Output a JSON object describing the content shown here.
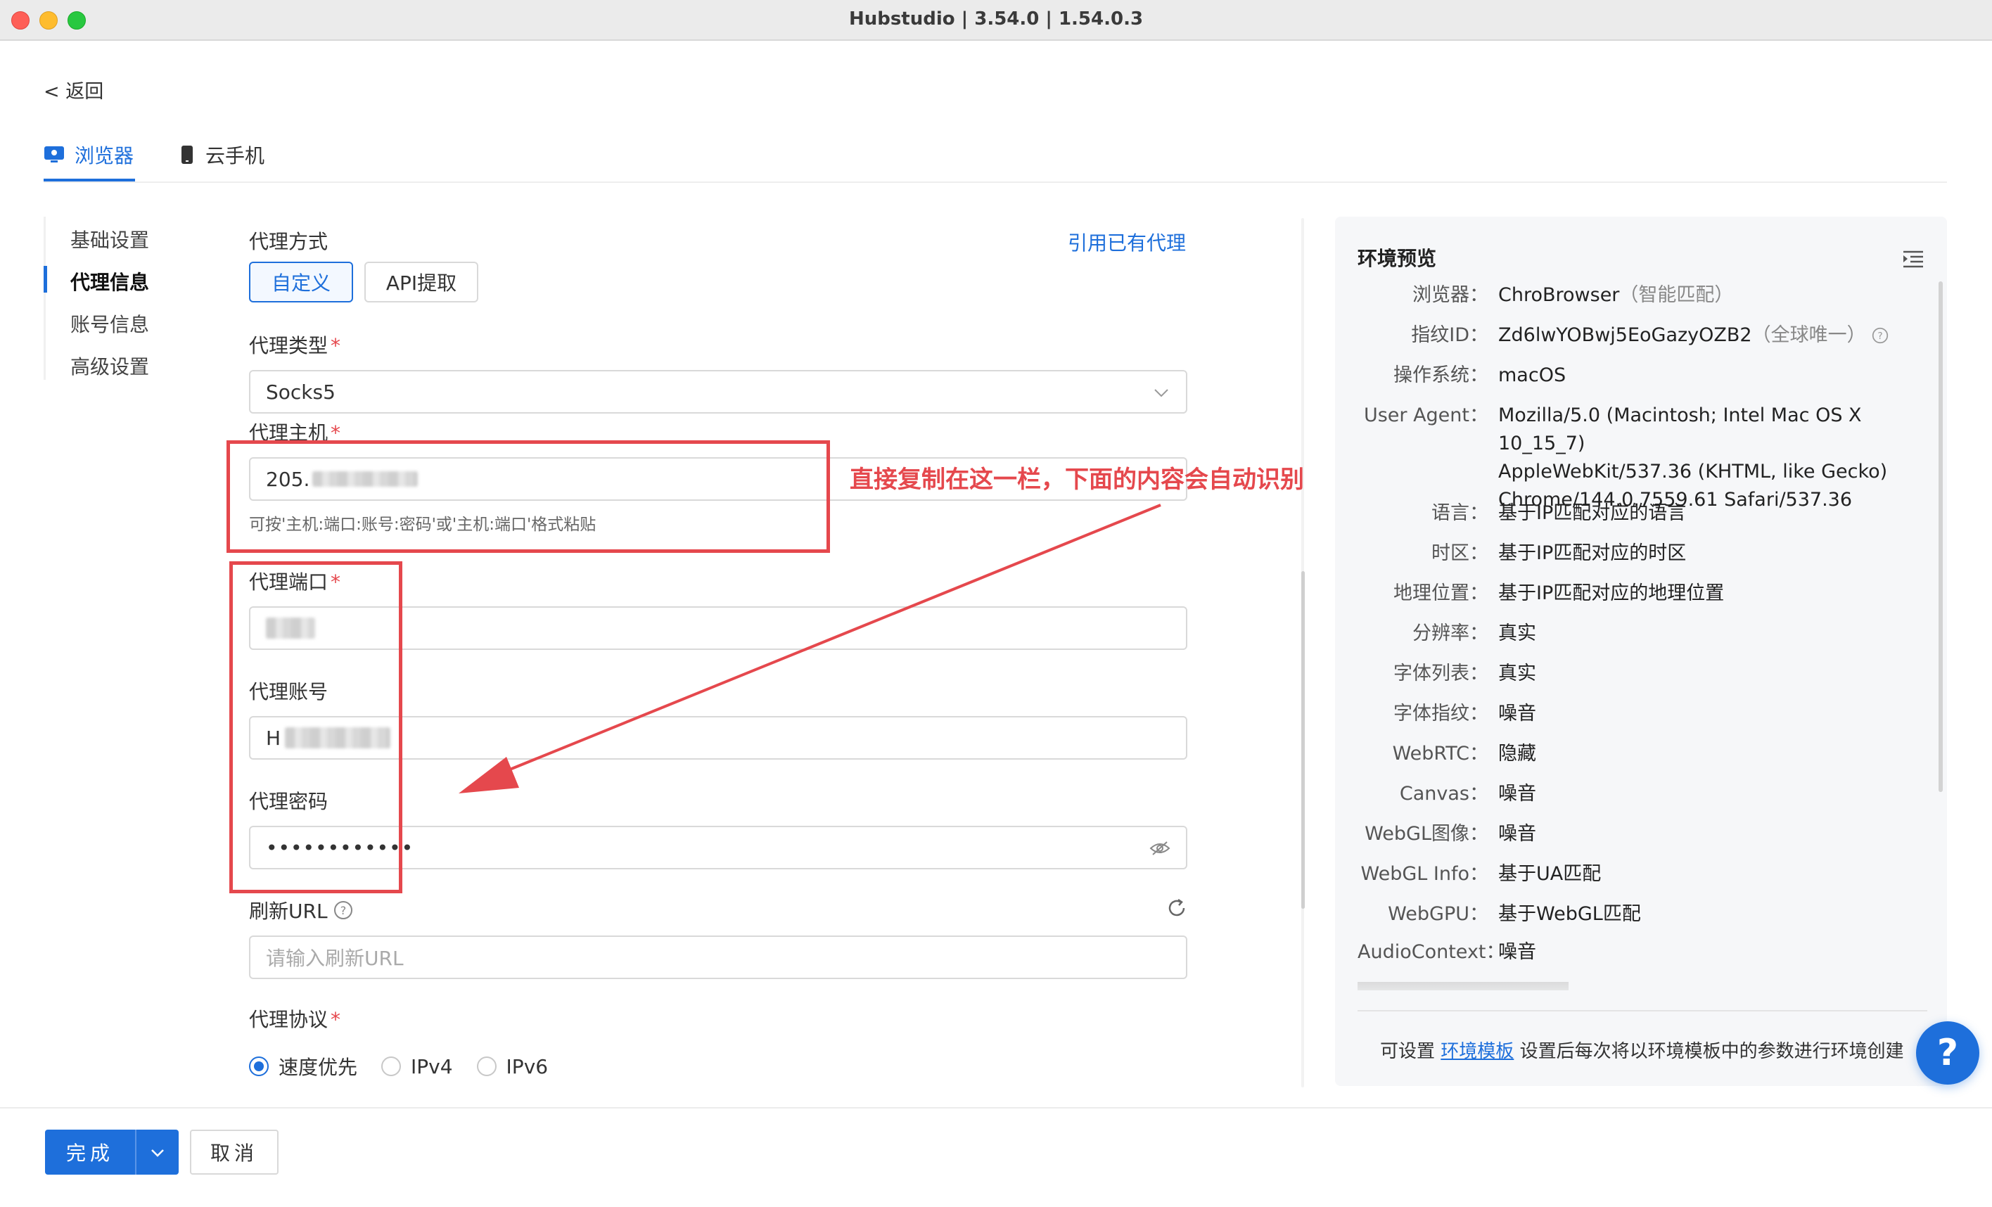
{
  "window": {
    "title": "Hubstudio | 3.54.0 | 1.54.0.3"
  },
  "back_label": "< 返回",
  "tabs": [
    {
      "label": "浏览器",
      "icon": "browser-icon",
      "active": true
    },
    {
      "label": "云手机",
      "icon": "phone-icon",
      "active": false
    }
  ],
  "menu": [
    {
      "label": "基础设置",
      "active": false
    },
    {
      "label": "代理信息",
      "active": true
    },
    {
      "label": "账号信息",
      "active": false
    },
    {
      "label": "高级设置",
      "active": false
    }
  ],
  "form": {
    "proxy_mode_label": "代理方式",
    "use_existing_proxy": "引用已有代理",
    "mode_options": [
      "自定义",
      "API提取"
    ],
    "mode_selected": "自定义",
    "proxy_type_label": "代理类型",
    "proxy_type_value": "Socks5",
    "host_label": "代理主机",
    "host_value": "205.",
    "host_hint": "可按'主机:端口:账号:密码'或'主机:端口'格式粘贴",
    "port_label": "代理端口",
    "account_label": "代理账号",
    "account_value": "H",
    "password_label": "代理密码",
    "password_value": "••••••••••••",
    "refresh_url_label": "刷新URL",
    "refresh_url_placeholder": "请输入刷新URL",
    "protocol_label": "代理协议",
    "protocol_options": [
      "速度优先",
      "IPv4",
      "IPv6"
    ],
    "protocol_selected": "速度优先",
    "required_mark": "*"
  },
  "annotation": {
    "text": "直接复制在这一栏，下面的内容会自动识别",
    "color": "#e5484d"
  },
  "preview": {
    "title": "环境预览",
    "rows": [
      {
        "key": "浏览器：",
        "value": "ChroBrowser",
        "extra": "（智能匹配）"
      },
      {
        "key": "指纹ID：",
        "value": "Zd6lwYOBwj5EoGazyOZB2",
        "extra": "（全球唯一）"
      },
      {
        "key": "操作系统：",
        "value": "macOS"
      },
      {
        "key": "User Agent：",
        "value_lines": [
          "Mozilla/5.0 (Macintosh; Intel Mac OS X 10_15_7)",
          "AppleWebKit/537.36 (KHTML, like Gecko)",
          "Chrome/144.0.7559.61 Safari/537.36"
        ]
      },
      {
        "key": "语言：",
        "value": "基于IP匹配对应的语言"
      },
      {
        "key": "时区：",
        "value": "基于IP匹配对应的时区"
      },
      {
        "key": "地理位置：",
        "value": "基于IP匹配对应的地理位置"
      },
      {
        "key": "分辨率：",
        "value": "真实"
      },
      {
        "key": "字体列表：",
        "value": "真实"
      },
      {
        "key": "字体指纹：",
        "value": "噪音"
      },
      {
        "key": "WebRTC：",
        "value": "隐藏"
      },
      {
        "key": "Canvas：",
        "value": "噪音"
      },
      {
        "key": "WebGL图像：",
        "value": "噪音"
      },
      {
        "key": "WebGL Info：",
        "value": "基于UA匹配"
      },
      {
        "key": "WebGPU：",
        "value": "基于WebGL匹配"
      },
      {
        "key": "AudioContext：",
        "value": "噪音"
      }
    ],
    "footer_prefix": "可设置",
    "footer_link": "环境模板",
    "footer_suffix": "设置后每次将以环境模板中的参数进行环境创建"
  },
  "help_label": "?",
  "footer": {
    "done_label": "完成",
    "cancel_label": "取消"
  },
  "colors": {
    "accent": "#1e6fdb",
    "annotation": "#e5484d",
    "panel_bg": "#f6f7f9"
  }
}
